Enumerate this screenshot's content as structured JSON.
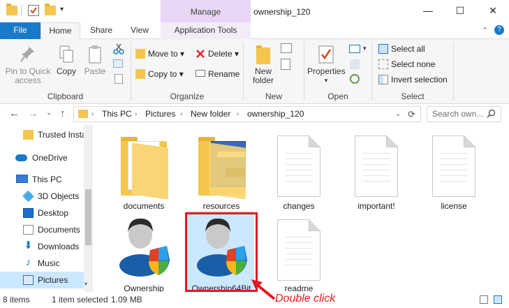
{
  "window": {
    "title": "ownership_120",
    "contextual_tab": "Manage",
    "minimize": "—",
    "maximize": "☐",
    "close": "✕"
  },
  "ribbon_tabs": [
    "File",
    "Home",
    "Share",
    "View",
    "Application Tools"
  ],
  "ribbon": {
    "clipboard": {
      "label": "Clipboard",
      "pin_line1": "Pin to Quick",
      "pin_line2": "access",
      "copy": "Copy",
      "paste": "Paste"
    },
    "organize": {
      "label": "Organize",
      "move_to": "Move to",
      "copy_to": "Copy to",
      "delete": "Delete",
      "rename": "Rename"
    },
    "new": {
      "label": "New",
      "new_folder_line1": "New",
      "new_folder_line2": "folder"
    },
    "open": {
      "label": "Open",
      "properties": "Properties"
    },
    "select": {
      "label": "Select",
      "select_all": "Select all",
      "select_none": "Select none",
      "invert": "Invert selection"
    }
  },
  "address": {
    "crumbs": [
      "This PC",
      "Pictures",
      "New folder",
      "ownership_120"
    ],
    "search_placeholder": "Search own..."
  },
  "nav": {
    "items": [
      "Trusted Insta",
      "OneDrive",
      "This PC",
      "3D Objects",
      "Desktop",
      "Documents",
      "Downloads",
      "Music",
      "Pictures"
    ]
  },
  "files": [
    {
      "name": "documents"
    },
    {
      "name": "resources"
    },
    {
      "name": "changes"
    },
    {
      "name": "important!"
    },
    {
      "name": "license"
    },
    {
      "name": "Ownership"
    },
    {
      "name": "Ownership64Bit"
    },
    {
      "name": "readme"
    }
  ],
  "status": {
    "items_count": "8 items",
    "selection": "1 item selected",
    "size": "1.09 MB"
  },
  "annotation": {
    "text": "Double click",
    "color": "#e8161e"
  },
  "colors": {
    "accent": "#1979ca",
    "manage_tab": "#e8d6f4",
    "selection": "#cce8ff",
    "folder": "#f4c64f"
  }
}
